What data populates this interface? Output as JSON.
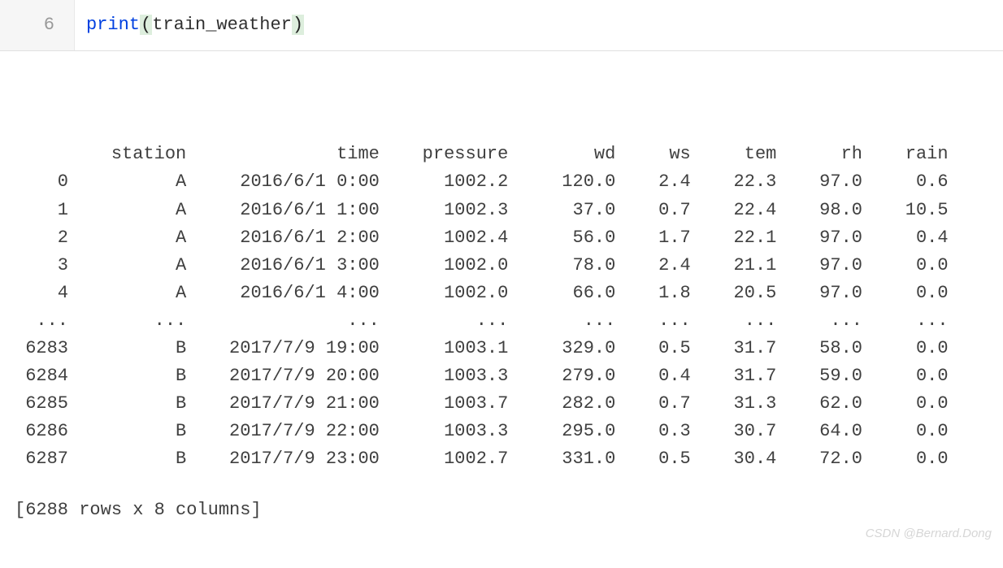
{
  "code": {
    "lineno": "6",
    "call": "print",
    "paren_open": "(",
    "var": "train_weather",
    "paren_close": ")"
  },
  "table": {
    "columns": [
      "",
      "station",
      "time",
      "pressure",
      "wd",
      "ws",
      "tem",
      "rh",
      "rain"
    ],
    "widths": [
      5,
      9,
      16,
      10,
      8,
      5,
      6,
      6,
      6
    ],
    "rows": [
      [
        "0",
        "A",
        "2016/6/1 0:00",
        "1002.2",
        "120.0",
        "2.4",
        "22.3",
        "97.0",
        "0.6"
      ],
      [
        "1",
        "A",
        "2016/6/1 1:00",
        "1002.3",
        "37.0",
        "0.7",
        "22.4",
        "98.0",
        "10.5"
      ],
      [
        "2",
        "A",
        "2016/6/1 2:00",
        "1002.4",
        "56.0",
        "1.7",
        "22.1",
        "97.0",
        "0.4"
      ],
      [
        "3",
        "A",
        "2016/6/1 3:00",
        "1002.0",
        "78.0",
        "2.4",
        "21.1",
        "97.0",
        "0.0"
      ],
      [
        "4",
        "A",
        "2016/6/1 4:00",
        "1002.0",
        "66.0",
        "1.8",
        "20.5",
        "97.0",
        "0.0"
      ],
      [
        "...",
        "...",
        "...",
        "...",
        "...",
        "...",
        "...",
        "...",
        "..."
      ],
      [
        "6283",
        "B",
        "2017/7/9 19:00",
        "1003.1",
        "329.0",
        "0.5",
        "31.7",
        "58.0",
        "0.0"
      ],
      [
        "6284",
        "B",
        "2017/7/9 20:00",
        "1003.3",
        "279.0",
        "0.4",
        "31.7",
        "59.0",
        "0.0"
      ],
      [
        "6285",
        "B",
        "2017/7/9 21:00",
        "1003.7",
        "282.0",
        "0.7",
        "31.3",
        "62.0",
        "0.0"
      ],
      [
        "6286",
        "B",
        "2017/7/9 22:00",
        "1003.3",
        "295.0",
        "0.3",
        "30.7",
        "64.0",
        "0.0"
      ],
      [
        "6287",
        "B",
        "2017/7/9 23:00",
        "1002.7",
        "331.0",
        "0.5",
        "30.4",
        "72.0",
        "0.0"
      ]
    ],
    "shape_line": "[6288 rows x 8 columns]"
  },
  "watermark": "CSDN @Bernard.Dong"
}
